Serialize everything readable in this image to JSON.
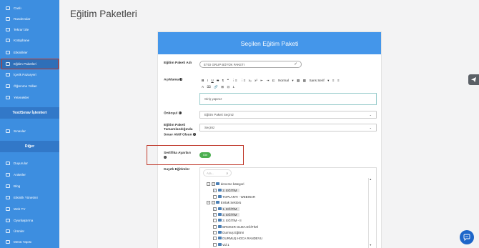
{
  "sidebar": {
    "items": [
      {
        "label": "Canlı",
        "icon": "live-icon"
      },
      {
        "label": "Randevular",
        "icon": "calendar-icon"
      },
      {
        "label": "Tekrar İzle",
        "icon": "replay-icon"
      },
      {
        "label": "Kütüphane",
        "icon": "library-icon"
      },
      {
        "label": "Etkinlikler",
        "icon": "event-icon"
      },
      {
        "label": "Eğitim Paketleri",
        "icon": "package-icon"
      },
      {
        "label": "İçerik Pazaryeri",
        "icon": "marketplace-icon"
      },
      {
        "label": "Öğrenme Yolları",
        "icon": "path-icon"
      },
      {
        "label": "Yetenekler",
        "icon": "skill-icon"
      }
    ],
    "section_test": "Test/Sınav İşlemleri",
    "test_items": [
      {
        "label": "Sınavlar",
        "icon": "exam-icon"
      }
    ],
    "section_other": "Diğer",
    "other_items": [
      {
        "label": "Duyurular",
        "icon": "announce-icon"
      },
      {
        "label": "Anketler",
        "icon": "survey-icon"
      },
      {
        "label": "Blog",
        "icon": "blog-icon"
      },
      {
        "label": "Etkinlik Yönetimi",
        "icon": "event-manage-icon"
      },
      {
        "label": "Web TV",
        "icon": "tv-icon"
      },
      {
        "label": "Oyunlaştırma",
        "icon": "game-icon"
      },
      {
        "label": "Ürünler",
        "icon": "product-icon"
      },
      {
        "label": "Menü Yapısı",
        "icon": "menu-icon"
      }
    ]
  },
  "page": {
    "title": "Eğitim Paketleri"
  },
  "card": {
    "header": "Seçilen Eğitim Paketi"
  },
  "form": {
    "name_label": "Eğitim Paketi Adı",
    "name_value": "ETGI GRUP BÜYÜK PAKETI",
    "desc_label": "Açıklama",
    "desc_value": "Giriş yapınız",
    "toolbar_row1": [
      "B",
      "I",
      "U",
      "S",
      "¶",
      "❝",
      "⋮≡",
      "⋮≡",
      "x₂",
      "x²",
      "⇤",
      "⇥",
      "⇇",
      "Normal",
      "▾",
      "▦",
      "▦",
      "Sans Serif",
      "▾",
      "≡",
      "≡"
    ],
    "toolbar_row2": [
      "A",
      "⌧",
      "🔗",
      "⊞",
      "⊡",
      "I̶"
    ],
    "prereq_label": "Önkoşul",
    "prereq_value": "Eğitim Paketi Seçiniz",
    "aftercomplete_label": "Eğitim Paketi Tamamlandığında Sınav Aktif Olsun",
    "aftercomplete_value": "Seçiniz",
    "cert_label": "Sertifika Ayarları",
    "cert_toggle": "Gör",
    "registered_label": "Kayıtlı Eğitimler",
    "search_placeholder": "Ara..."
  },
  "tree": [
    {
      "label": "deneme kategori",
      "level": 0,
      "expand": "−",
      "check": "partial",
      "folder": true,
      "sel": false
    },
    {
      "label": "2. EĞİTİM",
      "level": 1,
      "expand": "",
      "check": "checked",
      "folder": true,
      "sel": true
    },
    {
      "label": "TOPLANTI - WEBINAR",
      "level": 1,
      "expand": "",
      "check": "",
      "folder": true,
      "sel": false
    },
    {
      "label": "Emlak Sektörü",
      "level": 0,
      "expand": "−",
      "check": "partial",
      "folder": true,
      "sel": false
    },
    {
      "label": "1. EĞİTİM",
      "level": 1,
      "expand": "",
      "check": "checked",
      "folder": true,
      "sel": true
    },
    {
      "label": "2. EĞİTİM",
      "level": 1,
      "expand": "",
      "check": "checked",
      "folder": true,
      "sel": true
    },
    {
      "label": "3. EĞİTİM - II",
      "level": 1,
      "expand": "",
      "check": "",
      "folder": true,
      "sel": false
    },
    {
      "label": "BROKER OLMA EĞİTİMİ",
      "level": 1,
      "expand": "",
      "check": "",
      "folder": true,
      "sel": false
    },
    {
      "label": "Durmuş Eğitimi",
      "level": 1,
      "expand": "",
      "check": "",
      "folder": true,
      "sel": false
    },
    {
      "label": "DURMUŞ HOCA RANDEVU",
      "level": 1,
      "expand": "",
      "check": "",
      "folder": true,
      "sel": false
    },
    {
      "label": "vid 1",
      "level": 1,
      "expand": "",
      "check": "",
      "folder": true,
      "sel": false
    }
  ],
  "colors": {
    "sidebar": "#3d8ee0",
    "header": "#4496ea",
    "toggle": "#4caf50",
    "highlight": "#c0392b",
    "chat": "#1e66c9"
  }
}
